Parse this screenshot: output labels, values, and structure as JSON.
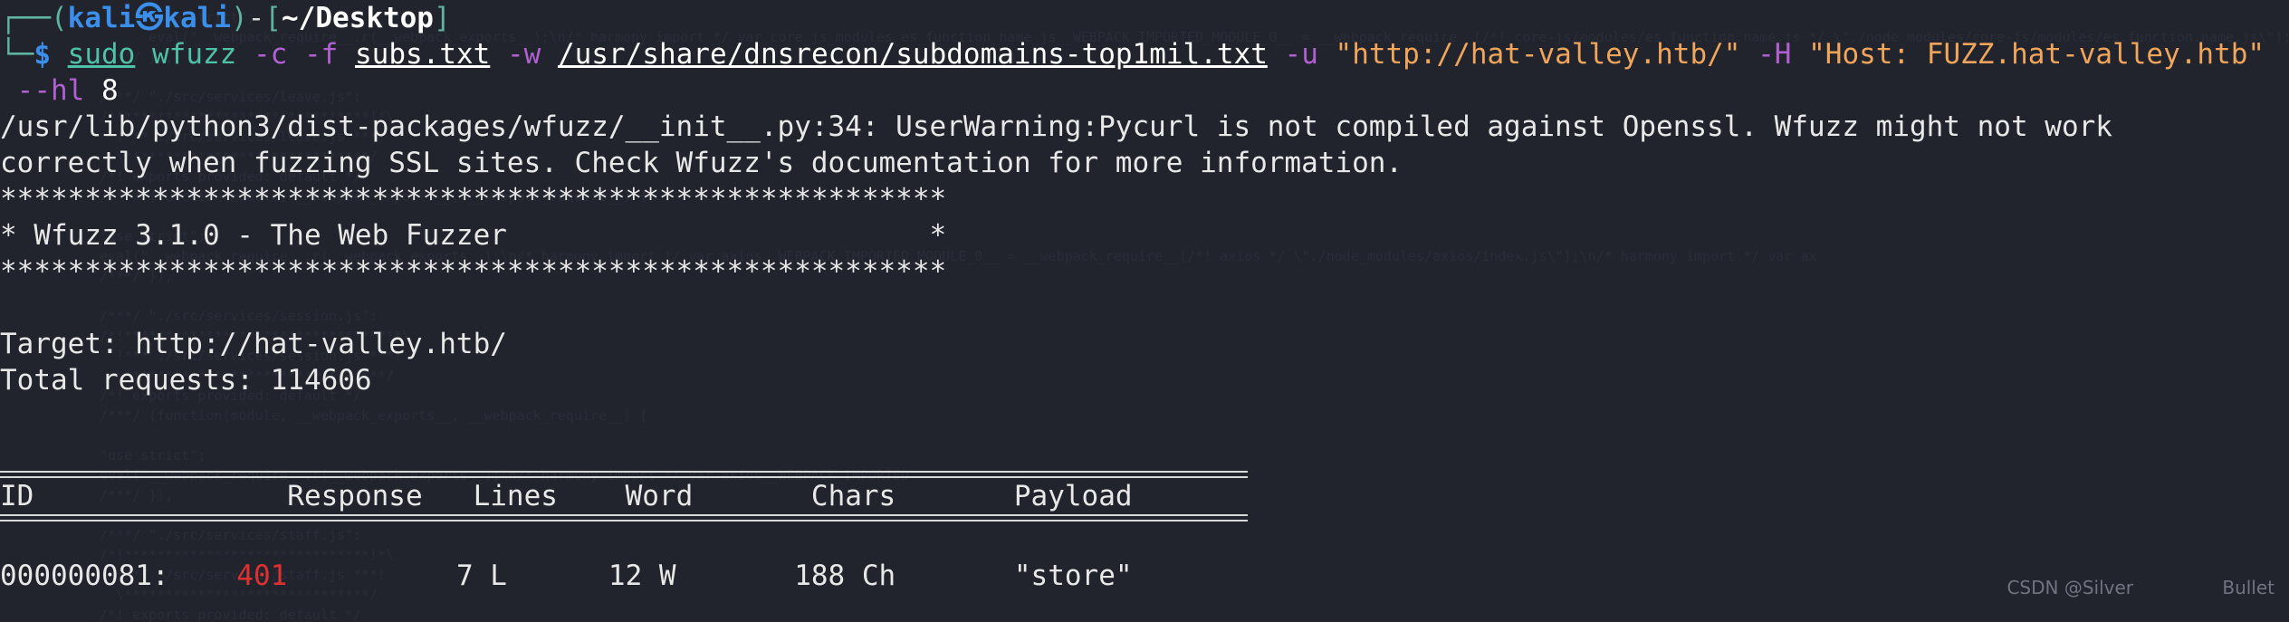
{
  "terminal": {
    "background_color": "#21242d",
    "foreground_color": "#e8e8e8",
    "prompt": {
      "frame_top": "┌──",
      "frame_bottom": "└─",
      "open_paren": "(",
      "user": "kali",
      "dragon_glyph": "㉿",
      "host": "kali",
      "close_paren": ")",
      "dash": "-",
      "open_bracket": "[",
      "cwd": "~/Desktop",
      "close_bracket": "]",
      "dollar": "$"
    },
    "command": {
      "sudo": "sudo",
      "program": "wfuzz",
      "flag_c": "-c",
      "flag_f": "-f",
      "file_subs": "subs.txt",
      "flag_w": "-w",
      "wordlist": "/usr/share/dnsrecon/subdomains-top1mil.txt",
      "flag_u": "-u",
      "url": "\"http://hat-valley.htb/\"",
      "flag_H": "-H",
      "header": "\"Host: FUZZ.hat-valley.htb\"",
      "flag_hl": "--hl",
      "hl_value": "8"
    },
    "warning": {
      "line1": "/usr/lib/python3/dist-packages/wfuzz/__init__.py:34: UserWarning:Pycurl is not compiled against Openssl. Wfuzz might not work",
      "line2": "correctly when fuzzing SSL sites. Check Wfuzz's documentation for more information."
    },
    "banner": {
      "rule": "********************************************************",
      "title": "* Wfuzz 3.1.0 - The Web Fuzzer                         *"
    },
    "info": {
      "target": "Target: http://hat-valley.htb/",
      "total_requests": "Total requests: 114606"
    },
    "table": {
      "headers": [
        "ID",
        "Response",
        "Lines",
        "Word",
        "Chars",
        "Payload"
      ],
      "rows": [
        {
          "id": "000000081:",
          "response": "401",
          "response_color": "#e03030",
          "lines": "7 L",
          "word": "12 W",
          "chars": "188 Ch",
          "payload": "\"store\""
        }
      ]
    },
    "watermarks": {
      "csdn": "CSDN @Silver",
      "bullet": "Bullet"
    },
    "ghost_code": "      \"use strict\";\n      eval(\"__webpack_require__.r(__webpack_exports__);\\n/* harmony import */ var core_js_modules_es_function_name_js__WEBPACK_IMPORTED_MODULE_0__ = __webpack_require__(/*! core-js/modules/es.function.name.js */ \\\"./node_modules/core-js/modules/es.function.name.js\\\");\\n/* harmony import */ var core_js_modules_es_function_name_js__WEBPACK_IM\n/***/ }),\n\n/***/ \"./src/services/leave.js\":\n/*!******************************!*\\\n  !*** ./src/services/leave.js ***!\n  \\******************************/\n/*! exports provided: default */\n/***/ (function(module, __webpack_exports__, __webpack_require__) {\n\n\"use strict\";\neval(\"__webpack_require__.r(__webpack_exports__);\\n/* harmony import */ var axios__WEBPACK_IMPORTED_MODULE_0__ = __webpack_require__(/*! axios */ \\\"./node_modules/axios/index.js\\\");\\n/* harmony import */ var ax\n/***/ }),\n\n/***/ \"./src/services/session.js\":\n/*!********************************!*\\\n  !*** ./src/services/session.js ***!\n  \\********************************/\n/*! exports provided: default */\n/***/ (function(module, __webpack_exports__, __webpack_require__) {\n\n\"use strict\";\neval(\"__webpack_require__.r(__webpack_exports__);\\n/* harmony import */ var axios__WEBPACK_IMPORTED\n/***/ }),\n\n/***/ \"./src/services/staff.js\":\n/*!******************************!*\\\n  !*** ./src/services/staff.js ***!\n  \\******************************/\n/*! exports provided: default */\n/***/ (function(module, __webpack_exports__, __webpack_require__) {\n\n\"use strict\";\neval(\"__webpack_require__.r(__webpack_exports__);\\n/* harmony import */ var axios__WEBPACK_IMPORTED_MODULE_0__ = __webp\n/***/ }),\n\n/***/ \"./src/services/status.js\":\n/*!*******************************!*\\\n  !*** ./src/services/status.js ***!\n  \\*******************************/\n/*! exports provided: default */"
  }
}
